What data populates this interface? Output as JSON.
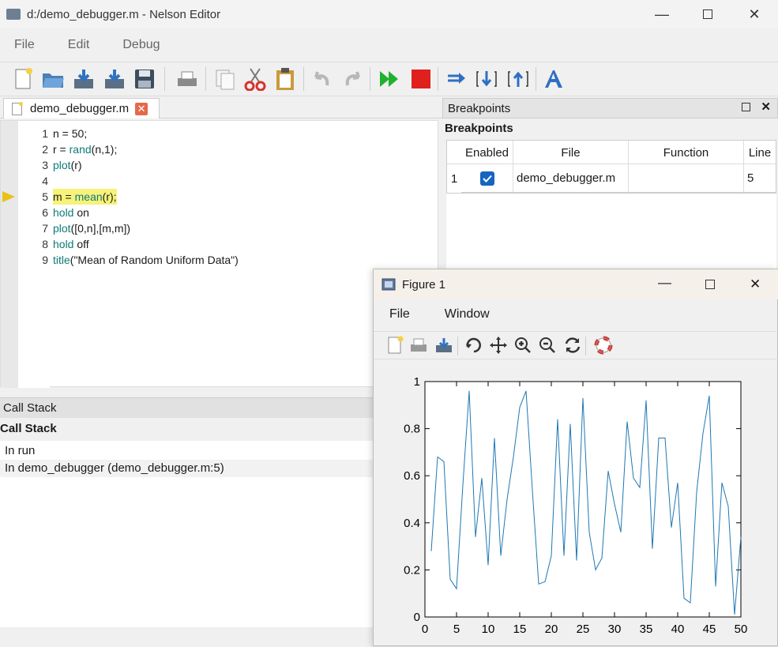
{
  "window": {
    "title": "d:/demo_debugger.m - Nelson Editor"
  },
  "menu": [
    "File",
    "Edit",
    "Debug"
  ],
  "editor": {
    "tab_label": "demo_debugger.m",
    "lines": [
      {
        "no": "1",
        "parts": [
          {
            "t": "n = 50;",
            "k": false
          }
        ]
      },
      {
        "no": "2",
        "parts": [
          {
            "t": "r = ",
            "k": false
          },
          {
            "t": "rand",
            "k": true
          },
          {
            "t": "(n,1);",
            "k": false
          }
        ]
      },
      {
        "no": "3",
        "parts": [
          {
            "t": "plot",
            "k": true
          },
          {
            "t": "(r)",
            "k": false
          }
        ]
      },
      {
        "no": "4",
        "parts": []
      },
      {
        "no": "5",
        "parts": [
          {
            "t": "m = ",
            "k": false
          },
          {
            "t": "mean",
            "k": true
          },
          {
            "t": "(r);",
            "k": false
          }
        ],
        "highlight": true
      },
      {
        "no": "6",
        "parts": [
          {
            "t": "hold",
            "k": true
          },
          {
            "t": " on",
            "k": false
          }
        ]
      },
      {
        "no": "7",
        "parts": [
          {
            "t": "plot",
            "k": true
          },
          {
            "t": "([0,n],[m,m])",
            "k": false
          }
        ]
      },
      {
        "no": "8",
        "parts": [
          {
            "t": "hold",
            "k": true
          },
          {
            "t": " off",
            "k": false
          }
        ]
      },
      {
        "no": "9",
        "parts": [
          {
            "t": "title",
            "k": true
          },
          {
            "t": "(\"Mean of Random Uniform Data\")",
            "k": false
          }
        ]
      }
    ]
  },
  "breakpoints": {
    "panel_title": "Breakpoints",
    "section_title": "Breakpoints",
    "columns": [
      "Enabled",
      "File",
      "Function",
      "Line"
    ],
    "rows": [
      {
        "index": "1",
        "enabled": true,
        "file": "demo_debugger.m",
        "function": "",
        "line": "5"
      }
    ]
  },
  "callstack": {
    "panel_title": "Call Stack",
    "section_title": "Call Stack",
    "rows": [
      "In run",
      "In demo_debugger (demo_debugger.m:5)"
    ]
  },
  "figure": {
    "title": "Figure 1",
    "menu": [
      "File",
      "Window"
    ]
  },
  "chart_data": {
    "type": "line",
    "xlim": [
      0,
      50
    ],
    "ylim": [
      0,
      1
    ],
    "x_ticks": [
      "0",
      "5",
      "10",
      "15",
      "20",
      "25",
      "30",
      "35",
      "40",
      "45",
      "50"
    ],
    "y_ticks": [
      "0",
      "0.2",
      "0.4",
      "0.6",
      "0.8",
      "1"
    ],
    "line_color": "#1f77b4",
    "series": [
      {
        "x": [
          1,
          2,
          3,
          4,
          5,
          6,
          7,
          8,
          9,
          10,
          11,
          12,
          13,
          14,
          15,
          16,
          17,
          18,
          19,
          20,
          21,
          22,
          23,
          24,
          25,
          26,
          27,
          28,
          29,
          30,
          31,
          32,
          33,
          34,
          35,
          36,
          37,
          38,
          39,
          40,
          41,
          42,
          43,
          44,
          45,
          46,
          47,
          48,
          49,
          50
        ],
        "values": [
          0.28,
          0.68,
          0.66,
          0.16,
          0.12,
          0.56,
          0.96,
          0.34,
          0.59,
          0.22,
          0.76,
          0.26,
          0.5,
          0.68,
          0.89,
          0.96,
          0.54,
          0.14,
          0.15,
          0.26,
          0.84,
          0.26,
          0.82,
          0.24,
          0.93,
          0.36,
          0.2,
          0.25,
          0.62,
          0.48,
          0.36,
          0.83,
          0.59,
          0.55,
          0.92,
          0.29,
          0.76,
          0.76,
          0.38,
          0.57,
          0.08,
          0.06,
          0.53,
          0.78,
          0.94,
          0.13,
          0.57,
          0.47,
          0.01,
          0.34
        ]
      }
    ]
  }
}
